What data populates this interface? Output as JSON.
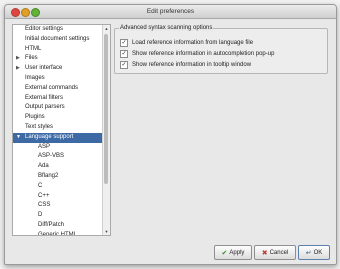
{
  "window": {
    "title": "Edit preferences"
  },
  "tree": {
    "items": [
      {
        "label": "Editor settings",
        "level": 0,
        "arrow": ""
      },
      {
        "label": "Initial document settings",
        "level": 0,
        "arrow": ""
      },
      {
        "label": "HTML",
        "level": 0,
        "arrow": ""
      },
      {
        "label": "Files",
        "level": 0,
        "arrow": "▶"
      },
      {
        "label": "User interface",
        "level": 0,
        "arrow": "▶"
      },
      {
        "label": "Images",
        "level": 0,
        "arrow": ""
      },
      {
        "label": "External commands",
        "level": 0,
        "arrow": ""
      },
      {
        "label": "External filters",
        "level": 0,
        "arrow": ""
      },
      {
        "label": "Output parsers",
        "level": 0,
        "arrow": ""
      },
      {
        "label": "Plugins",
        "level": 0,
        "arrow": ""
      },
      {
        "label": "Text styles",
        "level": 0,
        "arrow": ""
      },
      {
        "label": "Language support",
        "level": 0,
        "arrow": "▼",
        "selected": true
      },
      {
        "label": "ASP",
        "level": 1,
        "arrow": ""
      },
      {
        "label": "ASP-VBS",
        "level": 1,
        "arrow": ""
      },
      {
        "label": "Ada",
        "level": 1,
        "arrow": ""
      },
      {
        "label": "Bflang2",
        "level": 1,
        "arrow": ""
      },
      {
        "label": "C",
        "level": 1,
        "arrow": ""
      },
      {
        "label": "C++",
        "level": 1,
        "arrow": ""
      },
      {
        "label": "CSS",
        "level": 1,
        "arrow": ""
      },
      {
        "label": "D",
        "level": 1,
        "arrow": ""
      },
      {
        "label": "Diff/Patch",
        "level": 1,
        "arrow": ""
      },
      {
        "label": "Generic HTML",
        "level": 1,
        "arrow": ""
      }
    ]
  },
  "scrollbar": {
    "up": "▲",
    "down": "▼"
  },
  "panel": {
    "group_label": "Advanced syntax scanning options",
    "options": [
      {
        "label": "Load reference information from language file",
        "checked": true,
        "mark": "✓"
      },
      {
        "label": "Show reference information in autocompletion pop-up",
        "checked": true,
        "mark": "✓"
      },
      {
        "label": "Show reference information in tooltip window",
        "checked": true,
        "mark": "✓"
      }
    ]
  },
  "buttons": {
    "apply": {
      "label": "Apply",
      "icon": "✔"
    },
    "cancel": {
      "label": "Cancel",
      "icon": "✖"
    },
    "ok": {
      "label": "OK",
      "icon": "↵"
    }
  },
  "colors": {
    "selection": "#3d6aa5"
  }
}
